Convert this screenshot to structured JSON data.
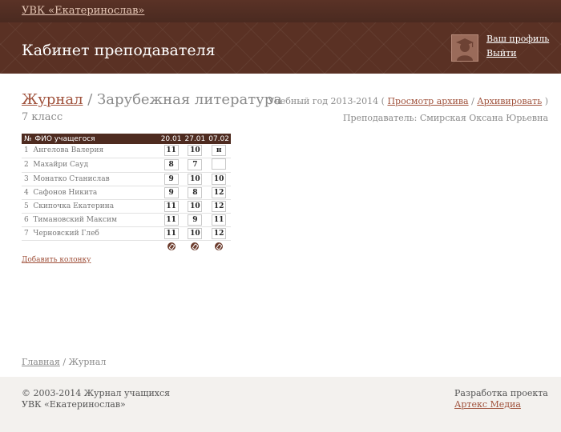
{
  "topbar": {
    "school_link": "УВК «Екатеринослав»"
  },
  "header": {
    "title": "Кабинет преподавателя",
    "profile_link": "Ваш профиль",
    "logout_link": "Выйти",
    "avatar_icon": "graduate-avatar-icon"
  },
  "page": {
    "journal_link": "Журнал",
    "separator": " / ",
    "subject": "Зарубежная литература",
    "class_label": "7 класс",
    "year_text": "Учебный год 2013-2014 (",
    "archive_view_link": "Просмотр архива",
    "year_sep": " / ",
    "archive_link": "Архивировать",
    "year_close": " )",
    "teacher": "Преподаватель: Смирская Оксана Юрьевна"
  },
  "table": {
    "headers": {
      "num": "№",
      "name": "ФИО учащегося",
      "dates": [
        "20.01",
        "27.01",
        "07.02"
      ]
    },
    "rows": [
      {
        "num": "1",
        "name": "Ангелова Валерия",
        "grades": [
          "11",
          "10",
          "н"
        ]
      },
      {
        "num": "2",
        "name": "Махайри Сауд",
        "grades": [
          "8",
          "7",
          ""
        ]
      },
      {
        "num": "3",
        "name": "Монатко Станислав",
        "grades": [
          "9",
          "10",
          "10"
        ]
      },
      {
        "num": "4",
        "name": "Сафонов Никита",
        "grades": [
          "9",
          "8",
          "12"
        ]
      },
      {
        "num": "5",
        "name": "Скипочка Екатерина",
        "grades": [
          "11",
          "10",
          "12"
        ]
      },
      {
        "num": "6",
        "name": "Тимановский Максим",
        "grades": [
          "11",
          "9",
          "11"
        ]
      },
      {
        "num": "7",
        "name": "Черновский Глеб",
        "grades": [
          "11",
          "10",
          "12"
        ]
      }
    ],
    "edit_icon": "edit-column-icon"
  },
  "add_column_link": "Добавить колонку",
  "breadcrumb": {
    "home": "Главная",
    "sep": " / ",
    "current": "Журнал"
  },
  "footer": {
    "copy_line1": "© 2003-2014 Журнал учащихся",
    "copy_line2": "УВК «Екатеринослав»",
    "dev_label": "Разработка проекта",
    "dev_link": "Артекс Медиа"
  },
  "colors": {
    "brand_dark": "#4e2b20",
    "link": "#a0523c",
    "footer_bg": "#f3f1ee"
  }
}
